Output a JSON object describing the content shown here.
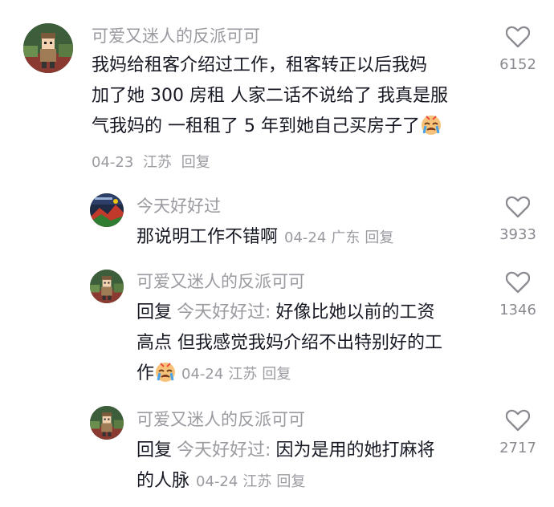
{
  "comments": [
    {
      "username": "可爱又迷人的反派可可",
      "lines": [
        "我妈给租客介绍过工作，租客转正以后我妈",
        "加了她 300 房租 人家二话不说给了 我真是服",
        "气我妈的 一租租了 5 年到她自己买房子了"
      ],
      "date": "04-23",
      "location": "江苏",
      "reply_label": "回复",
      "likes": "6152",
      "emoji": "crying-face-emoji"
    },
    {
      "username": "今天好好过",
      "text": "那说明工作不错啊",
      "date": "04-24",
      "location": "广东",
      "reply_label": "回复",
      "likes": "3933"
    },
    {
      "username": "可爱又迷人的反派可可",
      "reply_prefix": "回复",
      "reply_target": "今天好好过:",
      "lines": [
        "好像比她以前的工资",
        "高点 但我感觉我妈介绍不出特别好的工",
        "作"
      ],
      "date": "04-24",
      "location": "江苏",
      "reply_label": "回复",
      "likes": "1346",
      "emoji": "crying-face-emoji"
    },
    {
      "username": "可爱又迷人的反派可可",
      "reply_prefix": "回复",
      "reply_target": "今天好好过:",
      "lines": [
        "因为是用的她打麻将",
        "的人脉"
      ],
      "date": "04-24",
      "location": "江苏",
      "reply_label": "回复",
      "likes": "2717"
    }
  ],
  "colors": {
    "text": "#161823",
    "meta": "#9a9aa1",
    "heart": "#8a8a91"
  },
  "icons": {
    "like": "heart-outline-icon",
    "avatar_main": "cartoon-character-avatar",
    "avatar_reply": "landscape-avatar"
  }
}
